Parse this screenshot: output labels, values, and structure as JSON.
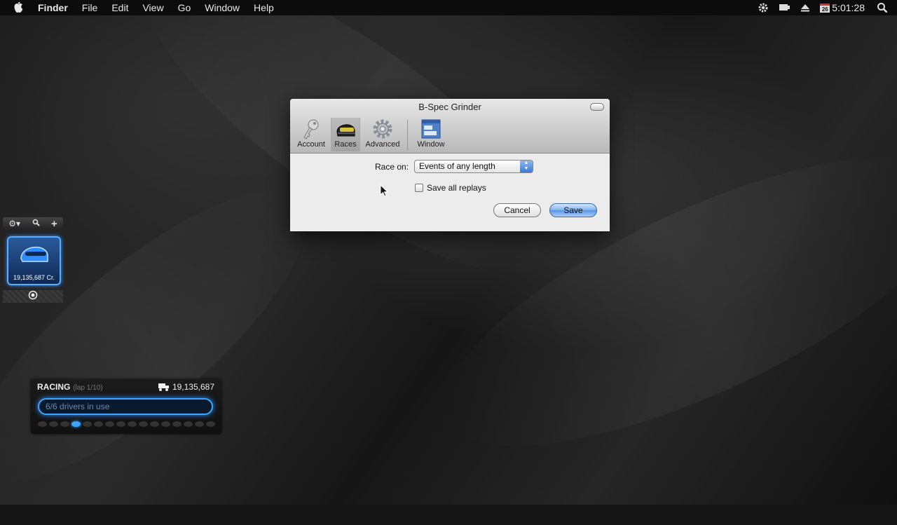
{
  "menubar": {
    "app": "Finder",
    "items": [
      "File",
      "Edit",
      "View",
      "Go",
      "Window",
      "Help"
    ],
    "calendar_day": "26",
    "clock": "5:01:28"
  },
  "dialog": {
    "title": "B-Spec Grinder",
    "toolbar": [
      "Account",
      "Races",
      "Advanced",
      "Window"
    ],
    "selected_tab": "Races",
    "race_on_label": "Race on:",
    "race_on_value": "Events of any length",
    "save_replays_label": "Save all replays",
    "save_replays_checked": false,
    "cancel_label": "Cancel",
    "save_label": "Save"
  },
  "garage_widget": {
    "credits": "19,135,687 Cr."
  },
  "racing_widget": {
    "status": "RACING",
    "lap": "(lap 1/10)",
    "credits": "19,135,687",
    "drivers": "6/6 drivers in use",
    "driver_slots": 16,
    "active_slot": 4
  },
  "colors": {
    "accent": "#3aa6ff",
    "menubar": "#0c0c0c"
  }
}
